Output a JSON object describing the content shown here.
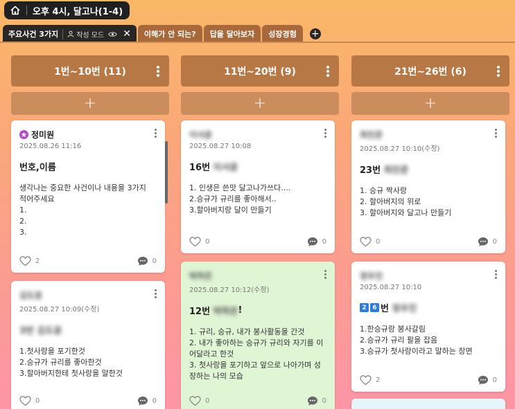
{
  "header": {
    "title": "오후 4시, 달고나(1-4)"
  },
  "tabs": [
    {
      "label": "주요사건 3가지",
      "mode": "작성 모드",
      "active": true
    },
    {
      "label": "이해가 안 되는?"
    },
    {
      "label": "답을 달아보자"
    },
    {
      "label": "성장경험"
    }
  ],
  "columns": [
    {
      "title": "1번~10번 (11)",
      "cards": [
        {
          "author": "정미원",
          "date": "2025.08.26 11:16",
          "title": "번호,이름",
          "body": "생각나는 중요한 사건이나 내용을 3가지\n적어주세요\n1.\n2.\n3.",
          "likes": "2",
          "comments": "0"
        },
        {
          "author": "김도윤",
          "date": "2025.08.27 10:09(수정)",
          "title": "3번 김도윤",
          "body": "1.첫사랑을 포기한것\n2.승규가 규리를 좋아한것\n3.할아버지한테 첫사랑을 말한것",
          "likes": "0",
          "comments": "0"
        }
      ]
    },
    {
      "title": "11번~20번 (9)",
      "cards": [
        {
          "author": "이서윤",
          "date": "2025.08.27 10:08",
          "title_prefix": "16번",
          "title_blur": "이서윤",
          "body": "1. 인생은 쓴맛 달고나가쓰다....\n2.승규가 규리를 좋아해서..\n3.할아버지랑 달이 만들기",
          "likes": "0",
          "comments": "0"
        },
        {
          "author": "박하은",
          "date": "2025.08.27 10:12(수정)",
          "title_prefix": "12번",
          "title_blur": "박하은",
          "title_suffix": "!",
          "body": "1. 규리, 승규, 내가 봉사활동을 간것\n2. 내가 좋아하는 승규가 규리와 자기를 이\n어달라고 한것\n3. 첫사랑을 포기하고 앞으로 나아가며 성\n장하는 나의 모습",
          "likes": "0",
          "comments": "0"
        }
      ]
    },
    {
      "title": "21번~26번 (6)",
      "cards": [
        {
          "author": "최민준",
          "date": "2025.08.27 10:10(수정)",
          "title_prefix": "23번",
          "title_blur": "최민준",
          "body": "1. 승규 짝사랑\n2. 할아버지의 위로\n3. 할아버지와 달고나 만들기",
          "likes": "0",
          "comments": "0"
        },
        {
          "author": "정우진",
          "date": "2025.08.27 10:10",
          "badges": [
            "2",
            "6"
          ],
          "title_prefix": "번",
          "title_blur": "정우진",
          "body": "1.한승규랑 봉사갈림\n2.승규가 규리 팔을 잡음\n3.승규가 첫사랑이라고 말하는 장면",
          "likes": "2",
          "comments": "0"
        }
      ]
    }
  ],
  "colors": {
    "header_bg": "#202020",
    "tab_bg": "#a8683a",
    "column_header": "#b87845",
    "add_btn": "#cc8d5c",
    "green_card": "#dff5d4"
  }
}
